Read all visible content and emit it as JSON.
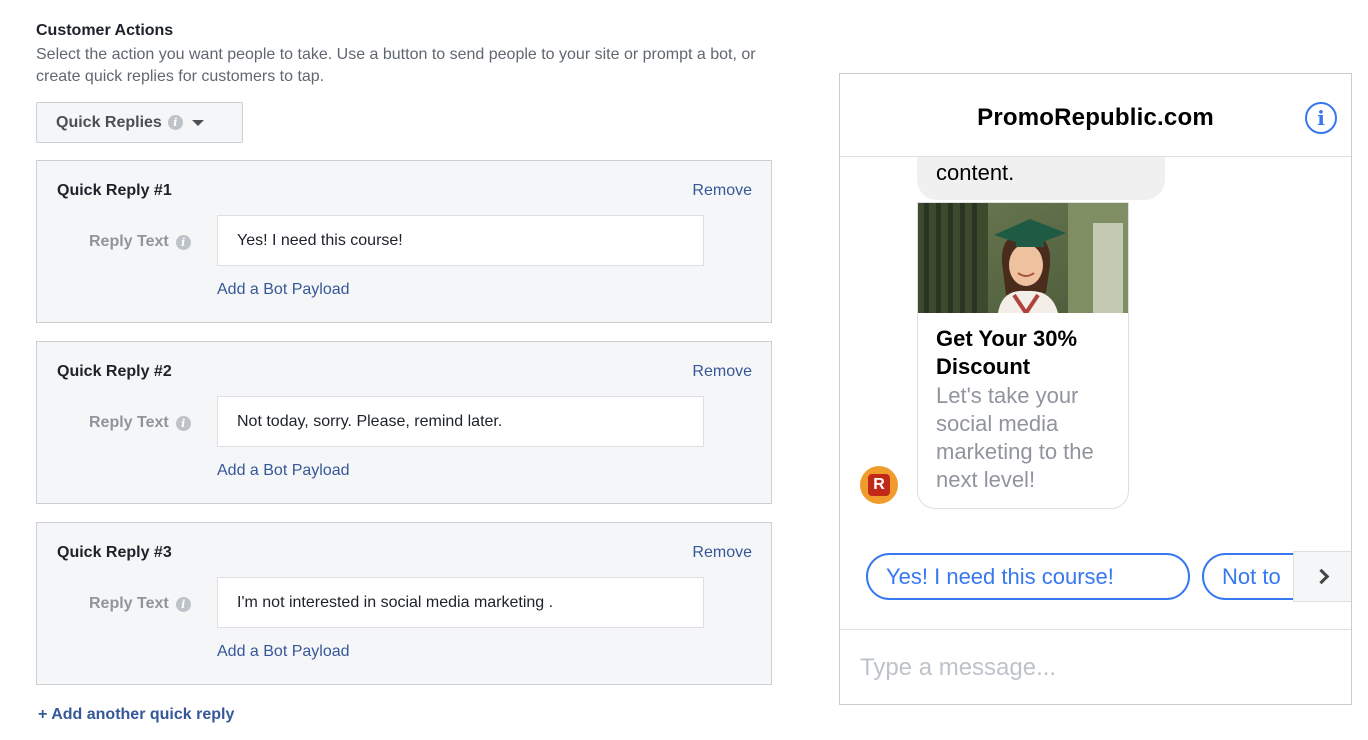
{
  "customer_actions": {
    "title": "Customer Actions",
    "description": "Select the action you want people to take. Use a button to send people to your site or prompt a bot, or create quick replies for customers to tap.",
    "dropdown_label": "Quick Replies"
  },
  "quick_replies": [
    {
      "title": "Quick Reply #1",
      "remove": "Remove",
      "label": "Reply Text",
      "value": "Yes! I need this course!",
      "payload_link": "Add a Bot Payload"
    },
    {
      "title": "Quick Reply #2",
      "remove": "Remove",
      "label": "Reply Text",
      "value": "Not today, sorry. Please, remind later.",
      "payload_link": "Add a Bot Payload"
    },
    {
      "title": "Quick Reply #3",
      "remove": "Remove",
      "label": "Reply Text",
      "value": "I'm not interested in social media marketing .",
      "payload_link": "Add a Bot Payload"
    }
  ],
  "add_reply_label": "+ Add another quick reply",
  "preview": {
    "page_name": "PromoRepublic.com",
    "info_icon": "i",
    "message_tail": "content.",
    "card": {
      "title": "Get Your 30% Discount",
      "subtitle": "Let's take your social media marketing to the next level!"
    },
    "avatar_letter": "R",
    "quick_reply_chips": [
      "Yes! I need this course!",
      "Not to"
    ],
    "input_placeholder": "Type a message..."
  },
  "colors": {
    "link": "#365899",
    "messenger_blue": "#3778f0",
    "panel_bg": "#f5f6f7",
    "avatar_orange": "#f09c2c"
  },
  "icons": [
    "info-icon",
    "caret-down-icon",
    "chevron-right-icon"
  ]
}
